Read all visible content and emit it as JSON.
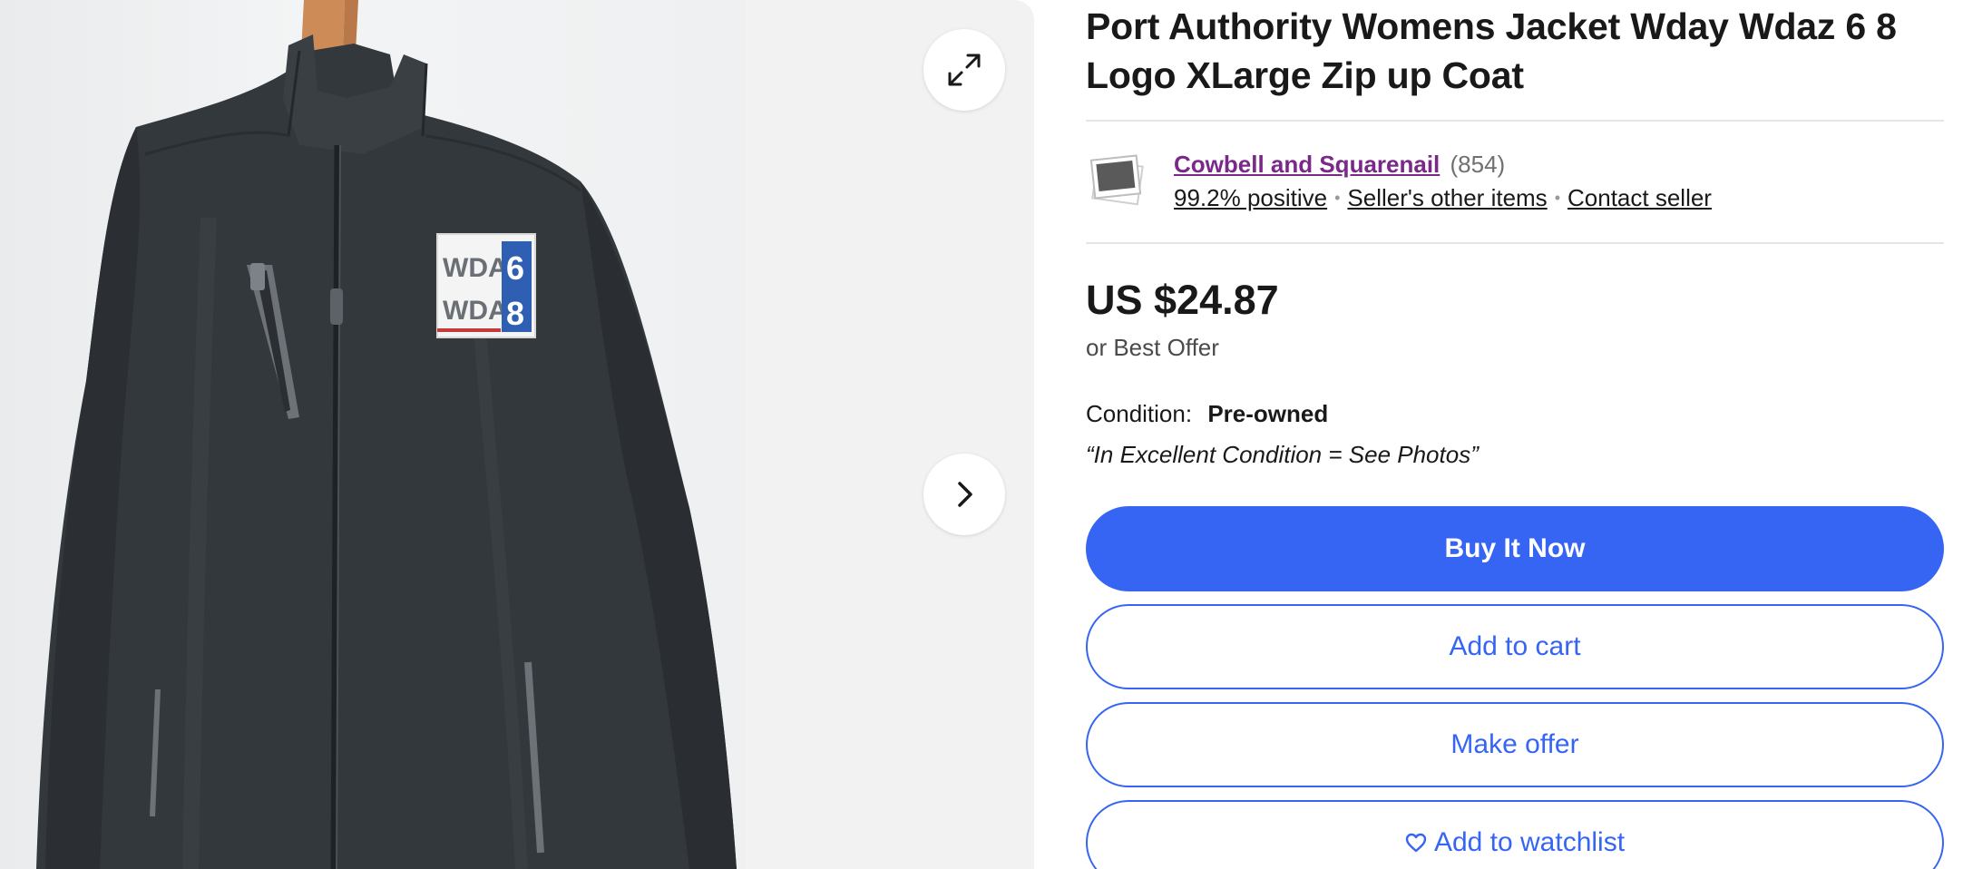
{
  "listing": {
    "title": "Port Authority Womens Jacket Wday Wdaz 6 8 Logo XLarge Zip up Coat"
  },
  "gallery": {
    "expand_icon": "expand-icon",
    "next_icon": "chevron-right-icon",
    "logo_text": {
      "line1": "WDAY",
      "line2": "WDAZ",
      "num1": "6",
      "num2": "8"
    }
  },
  "seller": {
    "name": "Cowbell and Squarenail",
    "feedback_count": "(854)",
    "positive": "99.2% positive",
    "other_items": "Seller's other items",
    "contact": "Contact seller"
  },
  "pricing": {
    "price": "US $24.87",
    "best_offer": "or Best Offer"
  },
  "condition": {
    "label": "Condition:",
    "value": "Pre-owned",
    "quote": "“In Excellent Condition = See Photos”"
  },
  "actions": {
    "buy_now": "Buy It Now",
    "add_to_cart": "Add to cart",
    "make_offer": "Make offer",
    "watchlist": "Add to watchlist"
  },
  "colors": {
    "primary_blue": "#3665f3",
    "seller_purple": "#7a2889",
    "jacket": "#33383c"
  }
}
